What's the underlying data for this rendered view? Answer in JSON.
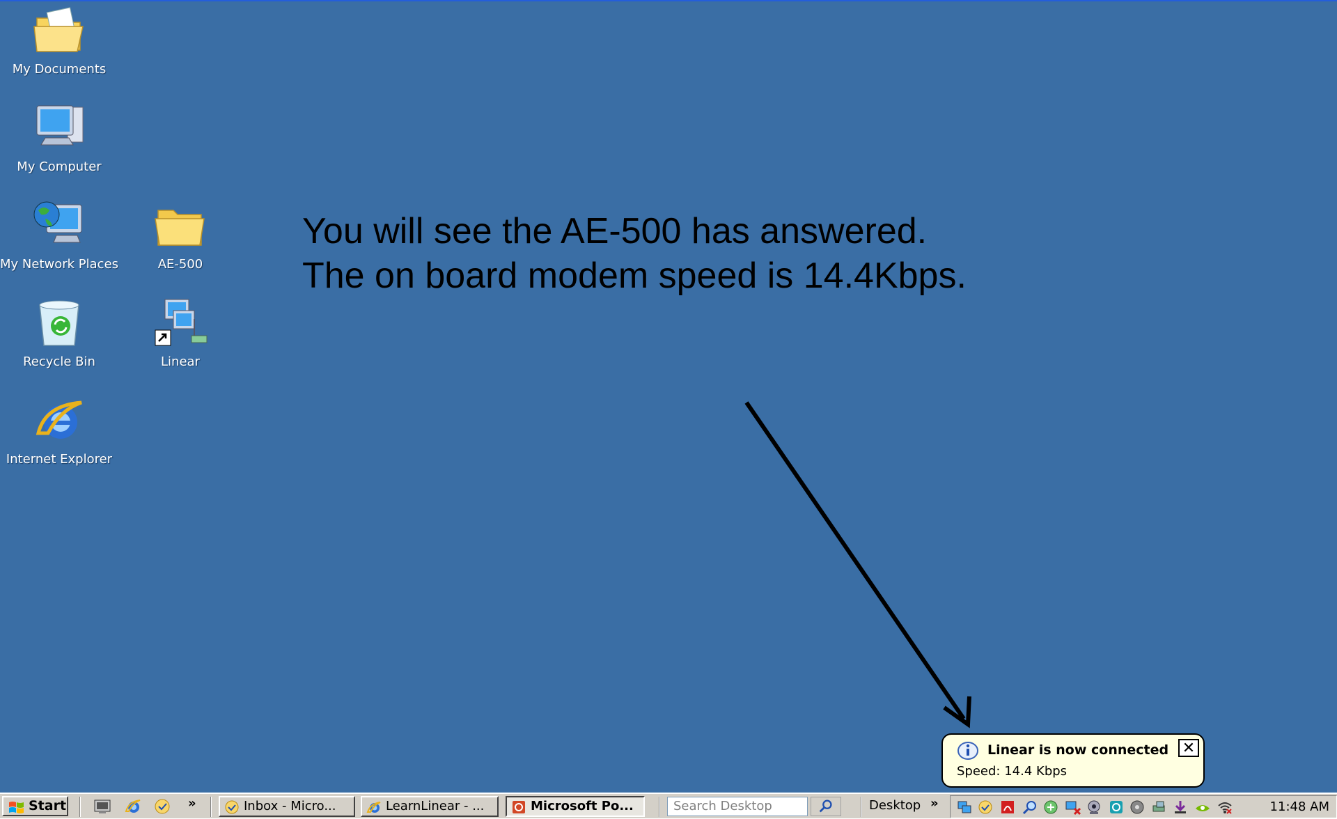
{
  "desktop": {
    "icons": [
      {
        "label": "My Documents"
      },
      {
        "label": "My Computer"
      },
      {
        "label": "My Network Places"
      },
      {
        "label": "AE-500"
      },
      {
        "label": "Recycle Bin"
      },
      {
        "label": "Linear"
      },
      {
        "label": "Internet Explorer"
      }
    ],
    "annotation": {
      "line1": "You will see the AE-500 has answered.",
      "line2": "The on board modem speed is 14.4Kbps."
    }
  },
  "balloon": {
    "title": "Linear is now connected",
    "body": "Speed: 14.4 Kbps",
    "close_label": "✕"
  },
  "taskbar": {
    "start_label": "Start",
    "quick_launch_more": "»",
    "tasks": [
      {
        "label": "Inbox - Micro...",
        "icon": "outlook-icon"
      },
      {
        "label": "LearnLinear - ...",
        "icon": "ie-icon"
      },
      {
        "label": "Microsoft Po...",
        "icon": "powerpoint-icon",
        "active": true
      }
    ],
    "search_placeholder": "Search Desktop",
    "desktop_toolbar_label": "Desktop",
    "desktop_toolbar_more": "»",
    "clock": "11:48 AM"
  },
  "colors": {
    "desktop_bg": "#3a6ea5",
    "taskbar_bg": "#d4d0c8",
    "balloon_bg": "#ffffe1"
  }
}
